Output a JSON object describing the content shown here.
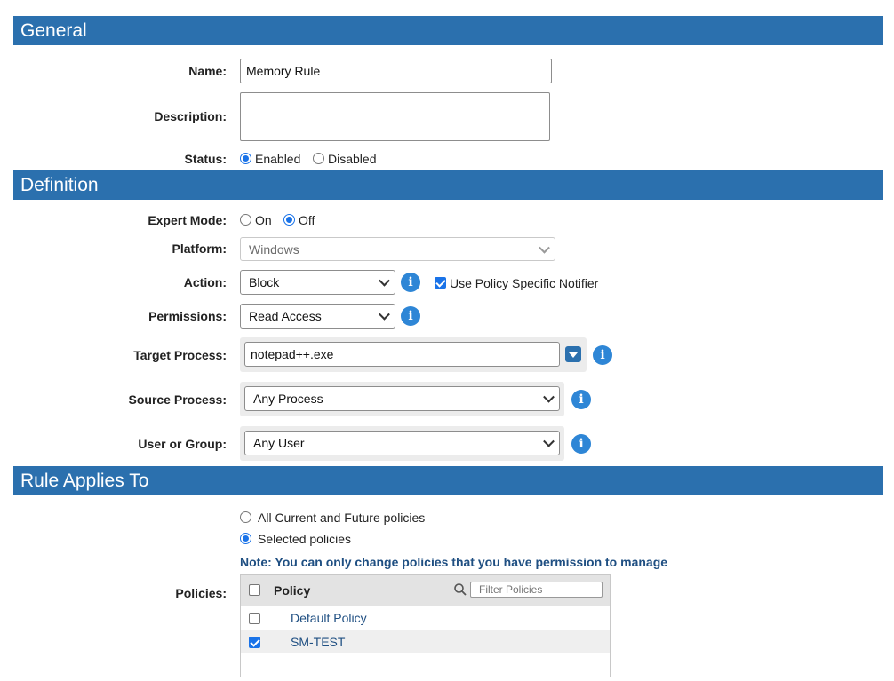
{
  "sections": {
    "general": "General",
    "definition": "Definition",
    "rule_applies": "Rule Applies To"
  },
  "general": {
    "name_label": "Name:",
    "name_value": "Memory Rule",
    "description_label": "Description:",
    "description_value": "",
    "status_label": "Status:",
    "status_options": [
      "Enabled",
      "Disabled"
    ],
    "status_selected": "Enabled"
  },
  "definition": {
    "expert_mode_label": "Expert Mode:",
    "expert_mode_options": [
      "On",
      "Off"
    ],
    "expert_mode_selected": "Off",
    "platform_label": "Platform:",
    "platform_value": "Windows",
    "action_label": "Action:",
    "action_value": "Block",
    "use_policy_notifier_label": "Use Policy Specific Notifier",
    "use_policy_notifier_checked": true,
    "permissions_label": "Permissions:",
    "permissions_value": "Read Access",
    "target_process_label": "Target Process:",
    "target_process_value": "notepad++.exe",
    "source_process_label": "Source Process:",
    "source_process_value": "Any Process",
    "user_group_label": "User or Group:",
    "user_group_value": "Any User"
  },
  "applies": {
    "option_all": "All Current and Future policies",
    "option_selected": "Selected policies",
    "selected": "Selected policies",
    "note": "Note: You can only change policies that you have permission to manage",
    "policies_label": "Policies:",
    "column_header": "Policy",
    "filter_placeholder": "Filter Policies",
    "rows": [
      {
        "name": "Default Policy",
        "checked": false
      },
      {
        "name": "SM-TEST",
        "checked": true
      }
    ]
  },
  "colors": {
    "section_bar": "#2b70ae",
    "accent": "#1a73e8",
    "info_icon": "#2e86d6",
    "link": "#1f4f82"
  },
  "icons": [
    "info-icon",
    "search-icon",
    "dropdown-arrow-icon"
  ]
}
